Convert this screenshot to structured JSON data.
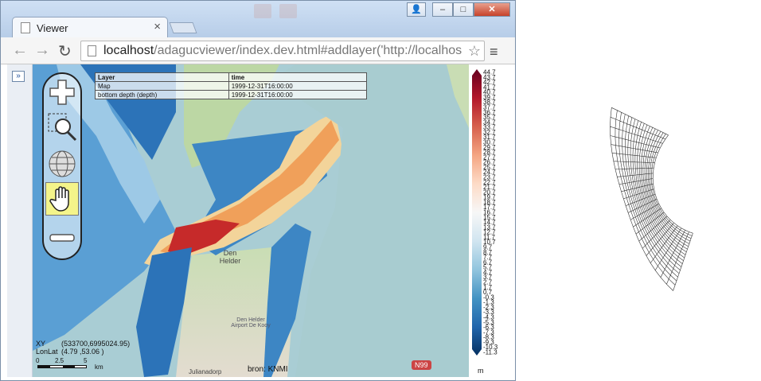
{
  "browser": {
    "tab_title": "Viewer",
    "tab_close": "×",
    "url_host": "localhost",
    "url_path": "/adagucviewer/index.dev.html#addlayer('http://localhos",
    "window_buttons": {
      "user": "👤",
      "minimize": "–",
      "maximize": "□",
      "close": "✕"
    },
    "nav": {
      "back": "←",
      "forward": "→",
      "reload": "↻",
      "star": "☆",
      "menu": "≡"
    }
  },
  "viewer": {
    "expand_label": "»",
    "legend_table": {
      "headers": [
        "Layer",
        "time"
      ],
      "rows": [
        [
          "Map",
          "1999-12-31T16:00:00"
        ],
        [
          "bottom depth (depth)",
          "1999-12-31T16:00:00"
        ]
      ]
    },
    "readout": {
      "xy_label": "XY",
      "xy_value": "(533700,6995024.95)",
      "lonlat_label": "LonLat",
      "lonlat_value": "(4.79   ,53.06       )"
    },
    "scale": {
      "ticks": [
        "0",
        "2.5",
        "5"
      ],
      "unit": "km"
    },
    "map_labels": {
      "town": "Den Helder",
      "source": "bron: KNMI",
      "road": "N99",
      "place1": "Den Helder Airport De Kooy",
      "place2": "Julianadorp"
    },
    "colorbar": {
      "unit": "m",
      "ticks": [
        "44.7",
        "43.7",
        "42.7",
        "41.7",
        "40.7",
        "39.7",
        "38.7",
        "37.7",
        "36.7",
        "35.7",
        "34.7",
        "33.7",
        "32.7",
        "31.7",
        "30.7",
        "29.7",
        "28.7",
        "27.7",
        "26.7",
        "25.7",
        "24.7",
        "23.7",
        "22.7",
        "21.7",
        "20.7",
        "19.7",
        "18.7",
        "17.7",
        "16.7",
        "15.7",
        "14.7",
        "13.7",
        "12.7",
        "11.7",
        "10.7",
        "9.7",
        "8.7",
        "7.7",
        "6.7",
        "5.7",
        "4.7",
        "3.7",
        "2.7",
        "1.7",
        "0.7",
        "-0.3",
        "-1.3",
        "-2.3",
        "-3.3",
        "-4.3",
        "-5.3",
        "-6.3",
        "-7.3",
        "-8.3",
        "-9.3",
        "-10.3",
        "-11.3"
      ],
      "colors": [
        "#67001f",
        "#b2182b",
        "#d6604d",
        "#f4a582",
        "#fddbc7",
        "#f7f7f7",
        "#d1e5f0",
        "#92c5de",
        "#4393c3",
        "#2166ac",
        "#053061"
      ]
    }
  }
}
